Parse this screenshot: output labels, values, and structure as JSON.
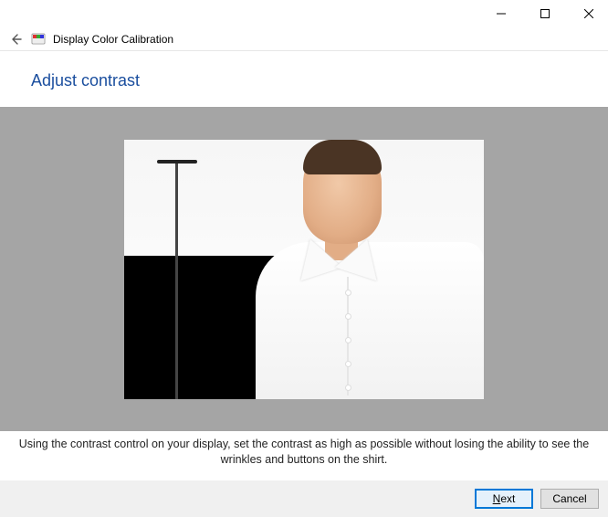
{
  "window": {
    "title": "Display Color Calibration"
  },
  "page": {
    "heading": "Adjust contrast",
    "instruction": "Using the contrast control on your display, set the contrast as high as possible without losing the ability to see the wrinkles and buttons on the shirt."
  },
  "buttons": {
    "next_prefix": "N",
    "next_rest": "ext",
    "cancel": "Cancel"
  }
}
